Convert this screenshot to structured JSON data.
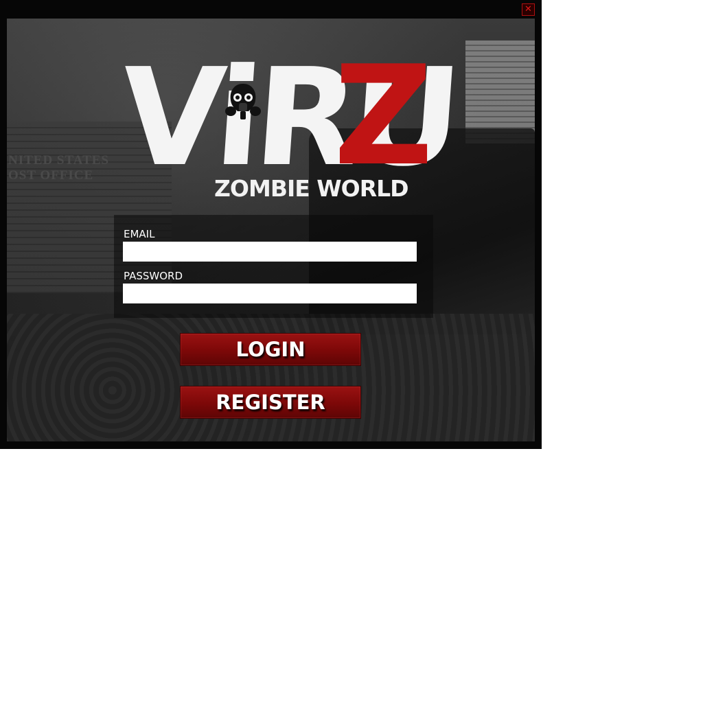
{
  "window": {
    "close_icon": "close-icon",
    "close_glyph": "✕"
  },
  "background": {
    "sign_text": "NITED STATES\nOST OFFICE"
  },
  "logo": {
    "main_text": "ViRU",
    "accent_letter": "Z",
    "subtitle": "ZOMBIE WORLD",
    "accent_color": "#c01414",
    "icon": "gas-mask-icon"
  },
  "form": {
    "email_label": "EMAIL",
    "email_value": "",
    "password_label": "PASSWORD",
    "password_value": ""
  },
  "buttons": {
    "login_label": "LOGIN",
    "register_label": "REGISTER",
    "button_color": "#8a0c0c"
  }
}
